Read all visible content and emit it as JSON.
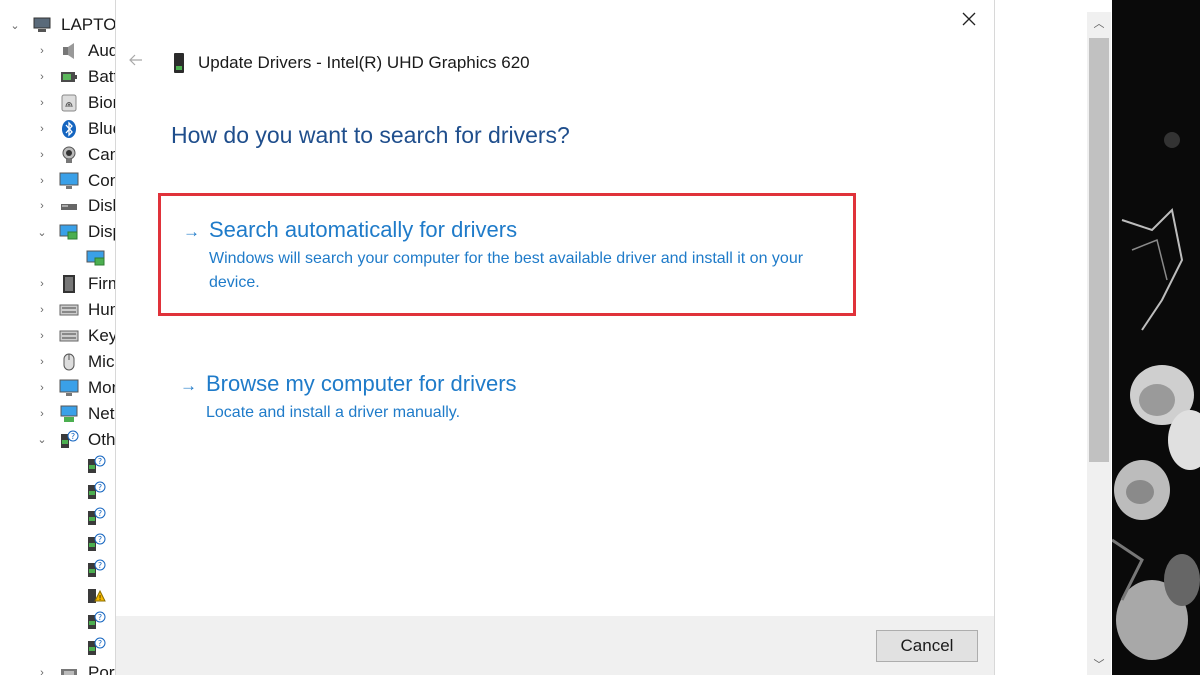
{
  "device_manager": {
    "root_label": "LAPTOP",
    "items": [
      {
        "label": "Audi",
        "icon": "speaker-icon",
        "expanded": false
      },
      {
        "label": "Batt",
        "icon": "battery-icon",
        "expanded": false
      },
      {
        "label": "Biom",
        "icon": "fingerprint-icon",
        "expanded": false
      },
      {
        "label": "Blue",
        "icon": "bluetooth-icon",
        "expanded": false
      },
      {
        "label": "Cam",
        "icon": "camera-icon",
        "expanded": false
      },
      {
        "label": "Con",
        "icon": "monitor-icon",
        "expanded": false
      },
      {
        "label": "Disk",
        "icon": "disk-drive-icon",
        "expanded": false
      },
      {
        "label": "Disp",
        "icon": "display-adapter-icon",
        "expanded": true
      },
      {
        "label": "",
        "icon": "display-adapter-icon",
        "child": true
      },
      {
        "label": "Firm",
        "icon": "firmware-icon",
        "expanded": false
      },
      {
        "label": "Hum",
        "icon": "keyboard-icon",
        "expanded": false
      },
      {
        "label": "Keyb",
        "icon": "keyboard-icon",
        "expanded": false
      },
      {
        "label": "Mic",
        "icon": "mouse-icon",
        "expanded": false
      },
      {
        "label": "Mon",
        "icon": "monitor-icon",
        "expanded": false
      },
      {
        "label": "Net",
        "icon": "network-icon",
        "expanded": false
      },
      {
        "label": "Oth",
        "icon": "unknown-device-icon",
        "expanded": true
      },
      {
        "label": "",
        "icon": "unknown-device-icon",
        "child": true
      },
      {
        "label": "",
        "icon": "unknown-device-icon",
        "child": true
      },
      {
        "label": "",
        "icon": "unknown-device-icon",
        "child": true
      },
      {
        "label": "",
        "icon": "unknown-device-icon",
        "child": true
      },
      {
        "label": "",
        "icon": "unknown-device-icon",
        "child": true
      },
      {
        "label": "",
        "icon": "warning-device-icon",
        "child": true
      },
      {
        "label": "",
        "icon": "unknown-device-icon",
        "child": true
      },
      {
        "label": "",
        "icon": "unknown-device-icon",
        "child": true
      },
      {
        "label": "Port",
        "icon": "port-icon",
        "expanded": false
      }
    ]
  },
  "dialog": {
    "title": "Update Drivers - Intel(R) UHD Graphics 620",
    "heading": "How do you want to search for drivers?",
    "options": [
      {
        "title": "Search automatically for drivers",
        "description": "Windows will search your computer for the best available driver and install it on your device.",
        "highlighted": true
      },
      {
        "title": "Browse my computer for drivers",
        "description": "Locate and install a driver manually.",
        "highlighted": false
      }
    ],
    "cancel_label": "Cancel"
  },
  "colors": {
    "link": "#1f7bc9",
    "heading": "#1f4e8c",
    "highlight_border": "#e0323a"
  }
}
